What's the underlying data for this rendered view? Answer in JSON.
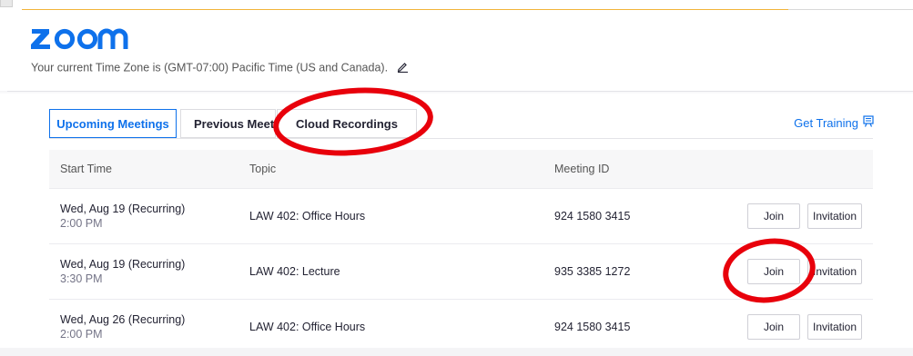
{
  "header": {
    "logo_text": "zoom",
    "timezone_text": "Your current Time Zone is (GMT-07:00) Pacific Time (US and Canada)."
  },
  "tabs": [
    {
      "label": "Upcoming Meetings",
      "active": true
    },
    {
      "label": "Previous Meetings",
      "active": false
    },
    {
      "label": "Cloud Recordings",
      "active": false
    }
  ],
  "training_link": "Get Training",
  "table": {
    "columns": [
      "Start Time",
      "Topic",
      "Meeting ID"
    ],
    "rows": [
      {
        "date": "Wed, Aug 19 (Recurring)",
        "time": "2:00 PM",
        "topic": "LAW 402: Office Hours",
        "meeting_id": "924 1580 3415",
        "join": "Join",
        "invitation": "Invitation"
      },
      {
        "date": "Wed, Aug 19 (Recurring)",
        "time": "3:30 PM",
        "topic": "LAW 402: Lecture",
        "meeting_id": "935 3385 1272",
        "join": "Join",
        "invitation": "Invitation"
      },
      {
        "date": "Wed, Aug 26 (Recurring)",
        "time": "2:00 PM",
        "topic": "LAW 402: Office Hours",
        "meeting_id": "924 1580 3415",
        "join": "Join",
        "invitation": "Invitation"
      }
    ]
  },
  "colors": {
    "brand_blue": "#0e71eb",
    "annotation_red": "#e8000b"
  },
  "icons": [
    "edit-pencil-icon",
    "training-icon"
  ]
}
